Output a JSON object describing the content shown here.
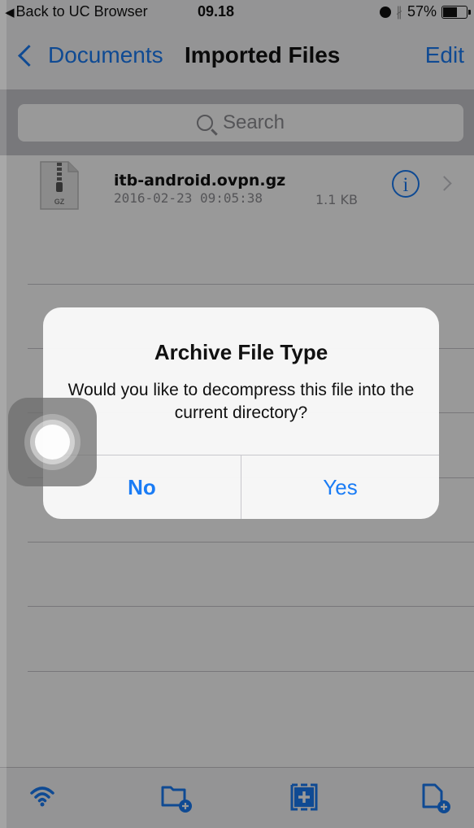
{
  "status": {
    "back_label": "Back to UC Browser",
    "time": "09.18",
    "battery": "57%"
  },
  "nav": {
    "back_label": "Documents",
    "title": "Imported Files",
    "edit_label": "Edit"
  },
  "search": {
    "placeholder": "Search"
  },
  "files": [
    {
      "name": "itb-android.ovpn.gz",
      "date": "2016-02-23 09:05:38",
      "size": "1.1 KB",
      "icon_label": "GZ"
    }
  ],
  "alert": {
    "title": "Archive File Type",
    "message": "Would you like to decompress this file into the current directory?",
    "no_label": "No",
    "yes_label": "Yes"
  },
  "toolbar": {
    "icons": [
      "wifi-icon",
      "new-folder-icon",
      "add-item-icon",
      "new-file-icon"
    ]
  },
  "colors": {
    "accent": "#1a7cf5"
  }
}
